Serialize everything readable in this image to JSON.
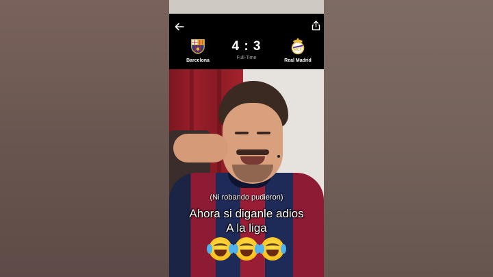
{
  "score_bar": {
    "home_team": "Barcelona",
    "away_team": "Real Madrid",
    "score": "4 : 3",
    "status": "Full-Time",
    "back_icon": "arrow-left-icon",
    "share_icon": "share-icon"
  },
  "captions": {
    "small": "(Ni robando pudieron)",
    "line1": "Ahora si diganle adios",
    "line2": "A la liga",
    "emoji_icon": "face-with-tears-of-joy-icon"
  },
  "colors": {
    "barca_blue": "#1e2a58",
    "barca_red": "#9a1d36",
    "madrid_gold": "#d9b44a"
  }
}
